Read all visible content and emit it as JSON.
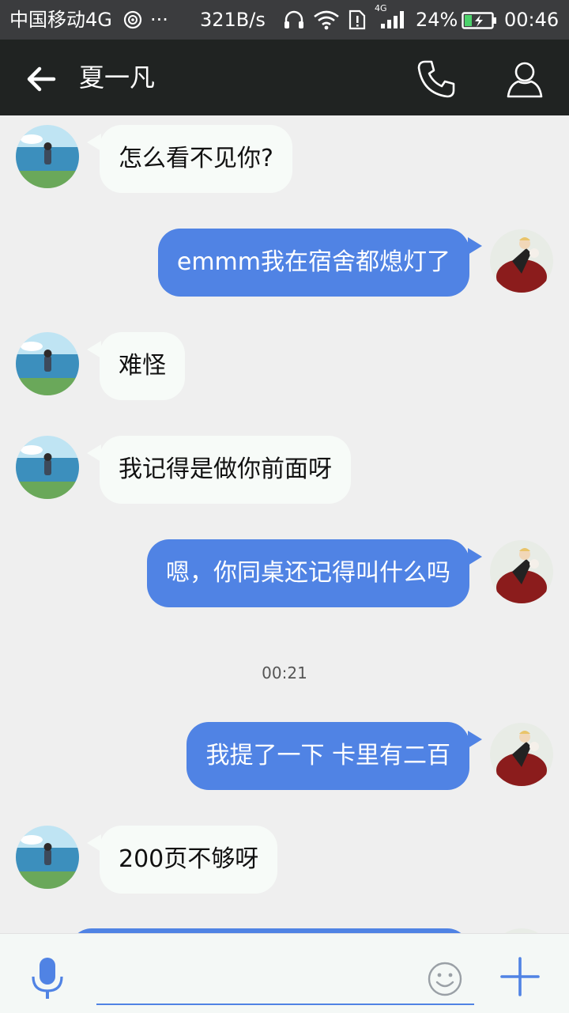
{
  "status_bar": {
    "carrier": "中国移动4G",
    "more": "···",
    "speed": "321B/s",
    "network_badge": "4G",
    "battery": "24%",
    "time": "00:46"
  },
  "header": {
    "title": "夏一凡",
    "back_icon": "arrow-left-icon",
    "call_icon": "phone-icon",
    "profile_icon": "person-icon"
  },
  "messages": [
    {
      "side": "in",
      "text": "怎么看不见你?"
    },
    {
      "side": "out",
      "text": "emmm我在宿舍都熄灯了"
    },
    {
      "side": "in",
      "text": "难怪"
    },
    {
      "side": "in",
      "text": "我记得是做你前面呀"
    },
    {
      "side": "out",
      "text": "嗯，你同桌还记得叫什么吗"
    },
    {
      "side": "time",
      "text": "00:21"
    },
    {
      "side": "out",
      "text": "我提了一下 卡里有二百"
    },
    {
      "side": "in",
      "text": "200页不够呀"
    }
  ],
  "input_bar": {
    "placeholder": "",
    "mic_icon": "microphone-icon",
    "emoji_icon": "smiley-icon",
    "add_icon": "plus-icon"
  },
  "colors": {
    "header_bg": "#202322",
    "status_bg": "#3b3c3e",
    "outgoing_bubble": "#5083e4",
    "incoming_bubble": "#f7fbf8",
    "chat_bg": "#efefef"
  }
}
